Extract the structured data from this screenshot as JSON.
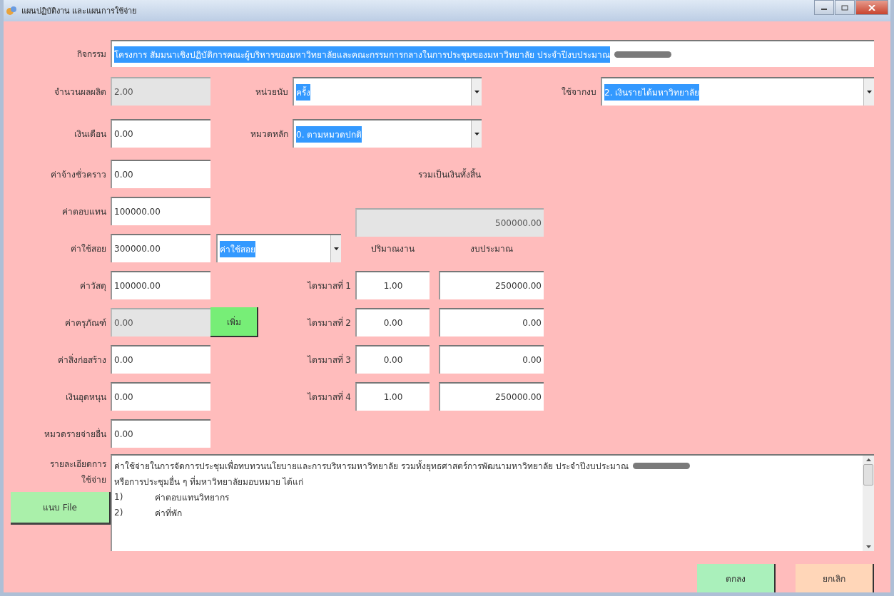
{
  "window": {
    "title": "แผนปฏิบัติงาน และแผนการใช้จ่าย"
  },
  "activity": {
    "label": "กิจกรรม",
    "value": "โครงการ สัมมนาเชิงปฏิบัติการคณะผู้บริหารของมหาวิทยาลัยและคณะกรรมการกลางในการประชุมของมหาวิทยาลัย ประจำปีงบประมาณ",
    "highlighted": true,
    "redacted": true
  },
  "output_count": {
    "label": "จำนวนผลผลิต",
    "value": "2.00",
    "disabled": true
  },
  "unit": {
    "label": "หน่วยนับ",
    "value": "ครั้ง",
    "highlighted": true
  },
  "budget_source": {
    "label": "ใช้จากงบ",
    "value": "2. เงินรายได้มหาวิทยาลัย",
    "highlighted": true
  },
  "main_category": {
    "label": "หมวดหลัก",
    "value": "0. ตามหมวดปกติ",
    "highlighted": true
  },
  "expense_fields": [
    {
      "label": "เงินเดือน",
      "value": "0.00",
      "disabled": false
    },
    {
      "label": "ค่าจ้างชั่วคราว",
      "value": "0.00",
      "disabled": false
    },
    {
      "label": "ค่าตอบแทน",
      "value": "100000.00",
      "disabled": false
    },
    {
      "label": "ค่าใช้สอย",
      "value": "300000.00",
      "disabled": false
    },
    {
      "label": "ค่าวัสดุ",
      "value": "100000.00",
      "disabled": false
    },
    {
      "label": "ค่าครุภัณฑ์",
      "value": "0.00",
      "disabled": true
    },
    {
      "label": "ค่าสิ่งก่อสร้าง",
      "value": "0.00",
      "disabled": false
    },
    {
      "label": "เงินอุดหนุน",
      "value": "0.00",
      "disabled": false
    },
    {
      "label": "หมวดรายจ่ายอื่น",
      "value": "0.00",
      "disabled": false
    }
  ],
  "expense_type": {
    "value": "ค่าใช้สอย",
    "highlighted": true
  },
  "add_button": "เพิ่ม",
  "total": {
    "label": "รวมเป็นเงินทั้งสิ้น",
    "value": "500000.00",
    "disabled": true
  },
  "quarters": {
    "columns": [
      "ปริมาณงาน",
      "งบประมาณ"
    ],
    "rows": [
      {
        "label": "ไตรมาสที่ 1",
        "quantity": "1.00",
        "budget": "250000.00"
      },
      {
        "label": "ไตรมาสที่ 2",
        "quantity": "0.00",
        "budget": "0.00"
      },
      {
        "label": "ไตรมาสที่ 3",
        "quantity": "0.00",
        "budget": "0.00"
      },
      {
        "label": "ไตรมาสที่ 4",
        "quantity": "1.00",
        "budget": "250000.00"
      }
    ]
  },
  "description": {
    "label": "รายละเอียดการใช้จ่าย",
    "lines": [
      {
        "text": "ค่าใช้จ่ายในการจัดการประชุมเพื่อทบทวนนโยบายและการบริหารมหาวิทยาลัย รวมทั้งยุทธศาสตร์การพัฒนามหาวิทยาลัย ประจำปีงบประมาณ",
        "redacted": true
      },
      {
        "text": "หรือการประชุมอื่น ๆ ที่มหาวิทยาลัยมอบหมาย ได้แก่"
      },
      {
        "number": "1)",
        "text": "ค่าตอบแทนวิทยากร"
      },
      {
        "number": "2)",
        "text": "ค่าที่พัก"
      }
    ]
  },
  "attach_button": "แนบ File",
  "buttons": [
    {
      "label": "ตกลง",
      "kind": "ok"
    },
    {
      "label": "ยกเลิก",
      "kind": "cancel"
    }
  ]
}
